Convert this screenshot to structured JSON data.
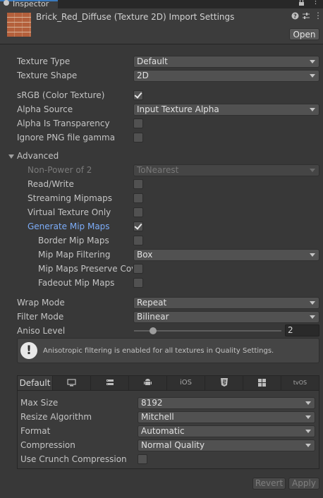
{
  "window": {
    "tab_label": "Inspector",
    "title": "Brick_Red_Diffuse (Texture 2D) Import Settings",
    "open_button": "Open"
  },
  "fields": {
    "texture_type": {
      "label": "Texture Type",
      "value": "Default"
    },
    "texture_shape": {
      "label": "Texture Shape",
      "value": "2D"
    },
    "srgb": {
      "label": "sRGB (Color Texture)",
      "checked": true
    },
    "alpha_source": {
      "label": "Alpha Source",
      "value": "Input Texture Alpha"
    },
    "alpha_is_transparency": {
      "label": "Alpha Is Transparency",
      "checked": false
    },
    "ignore_png_gamma": {
      "label": "Ignore PNG file gamma",
      "checked": false
    }
  },
  "advanced": {
    "label": "Advanced",
    "non_power_of_2": {
      "label": "Non-Power of 2",
      "value": "ToNearest"
    },
    "read_write": {
      "label": "Read/Write",
      "checked": false
    },
    "streaming_mipmaps": {
      "label": "Streaming Mipmaps",
      "checked": false
    },
    "virtual_texture_only": {
      "label": "Virtual Texture Only",
      "checked": false
    },
    "generate_mip_maps": {
      "label": "Generate Mip Maps",
      "checked": true
    },
    "border_mip_maps": {
      "label": "Border Mip Maps",
      "checked": false
    },
    "mip_map_filtering": {
      "label": "Mip Map Filtering",
      "value": "Box"
    },
    "mip_maps_preserve_coverage": {
      "label": "Mip Maps Preserve Cov",
      "checked": false
    },
    "fadeout_mip_maps": {
      "label": "Fadeout Mip Maps",
      "checked": false
    }
  },
  "sampling": {
    "wrap_mode": {
      "label": "Wrap Mode",
      "value": "Repeat"
    },
    "filter_mode": {
      "label": "Filter Mode",
      "value": "Bilinear"
    },
    "aniso_level": {
      "label": "Aniso Level",
      "value": "2",
      "slider_fraction": 0.13
    }
  },
  "help_message": "Anisotropic filtering is enabled for all textures in Quality Settings.",
  "platform_tabs": [
    {
      "label": "Default",
      "icon": "default"
    },
    {
      "label": "",
      "icon": "monitor-icon"
    },
    {
      "label": "",
      "icon": "server-icon"
    },
    {
      "label": "",
      "icon": "android-icon"
    },
    {
      "label": "iOS",
      "icon": "ios"
    },
    {
      "label": "",
      "icon": "html5-icon"
    },
    {
      "label": "",
      "icon": "windows-icon"
    },
    {
      "label": "tvOS",
      "icon": "tvos"
    }
  ],
  "platform_settings": {
    "max_size": {
      "label": "Max Size",
      "value": "8192"
    },
    "resize_algorithm": {
      "label": "Resize Algorithm",
      "value": "Mitchell"
    },
    "format": {
      "label": "Format",
      "value": "Automatic"
    },
    "compression": {
      "label": "Compression",
      "value": "Normal Quality"
    },
    "use_crunch_compression": {
      "label": "Use Crunch Compression",
      "checked": false
    }
  },
  "footer": {
    "revert": "Revert",
    "apply": "Apply"
  },
  "colors": {
    "background": "#383838",
    "accent_blue": "#7cacf8",
    "tab_accent": "#3a79bb"
  }
}
